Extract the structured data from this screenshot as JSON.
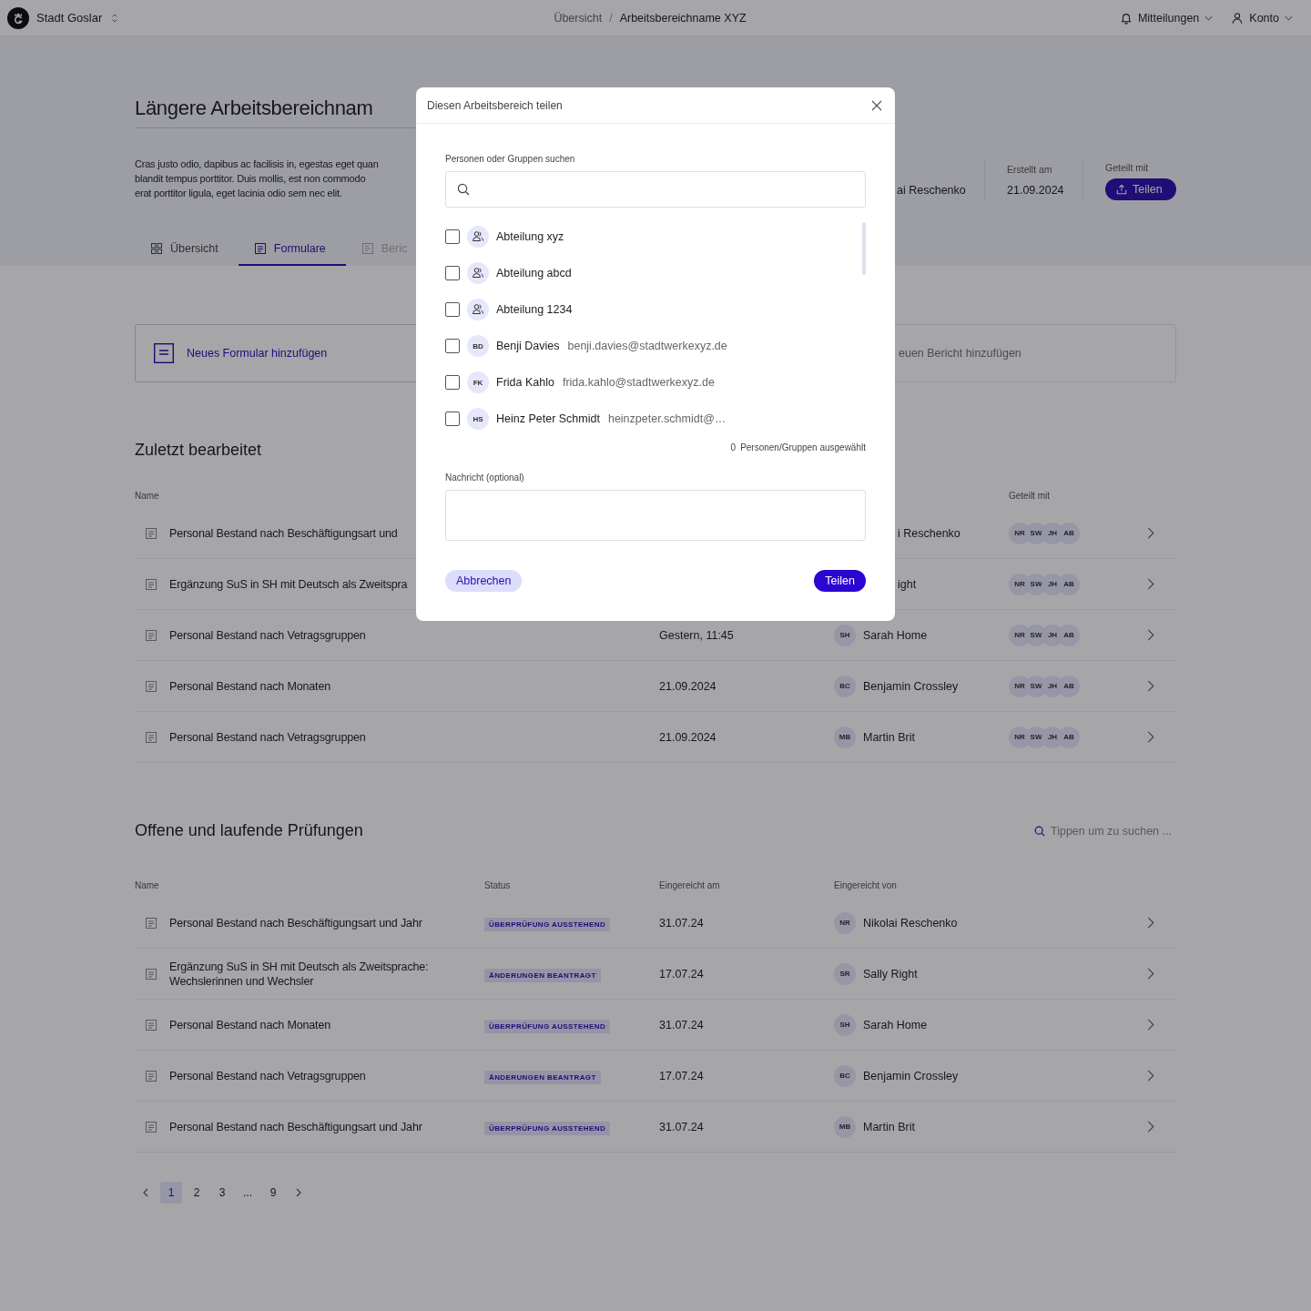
{
  "topbar": {
    "org": "Stadt Goslar",
    "breadcrumb": [
      {
        "label": "Übersicht",
        "current": false
      },
      {
        "label": "Arbeitsbereichname XYZ",
        "current": true
      }
    ],
    "breadcrumb_separator": "/",
    "notifications": "Mitteilungen",
    "account": "Konto"
  },
  "workspace": {
    "title": "Längere Arbeitsbereichnam",
    "description_lines": [
      "Cras justo odio, dapibus ac facilisis in, egestas eget quan",
      "blandit tempus porttitor. Duis mollis, est non commodo",
      "erat porttitor ligula, eget lacinia odio sem nec elit."
    ],
    "creator": "ai Reschenko",
    "created_label": "Erstellt am",
    "created": "21.09.2024",
    "shared_label": "Geteilt mit",
    "share_button": "Teilen"
  },
  "tabs": [
    {
      "label": "Übersicht",
      "selected": false,
      "disabled": false
    },
    {
      "label": "Formulare",
      "selected": true,
      "disabled": false
    },
    {
      "label": "Beric",
      "selected": false,
      "disabled": true
    }
  ],
  "actions": [
    {
      "label": "Neues Formular hinzufügen",
      "disabled": false
    },
    {
      "label": "euen Bericht hinzufügen",
      "disabled": true
    }
  ],
  "recent": {
    "title": "Zuletzt bearbeitet",
    "name_header": "Name",
    "shared_header": "Geteilt mit",
    "rows": [
      {
        "name": "Personal Bestand nach Beschäftigungsart und",
        "person": "i Reschenko",
        "shared": [
          "NR",
          "SW",
          "JH",
          "AB"
        ]
      },
      {
        "name": "Ergänzung SuS in SH mit Deutsch als Zweitspra",
        "person": "ight",
        "shared": [
          "NR",
          "SW",
          "JH",
          "AB"
        ]
      },
      {
        "name": "Personal Bestand nach Vetragsgruppen",
        "date": "Gestern, 11:45",
        "avatar": "SH",
        "person": "Sarah Home",
        "shared": [
          "NR",
          "SW",
          "JH",
          "AB"
        ]
      },
      {
        "name": "Personal Bestand nach Monaten",
        "date": "21.09.2024",
        "avatar": "BC",
        "person": "Benjamin Crossley",
        "shared": [
          "NR",
          "SW",
          "JH",
          "AB"
        ]
      },
      {
        "name": "Personal Bestand nach Vetragsgruppen",
        "date": "21.09.2024",
        "avatar": "MB",
        "person": "Martin Brit",
        "shared": [
          "NR",
          "SW",
          "JH",
          "AB"
        ]
      }
    ]
  },
  "reviews": {
    "title": "Offene und laufende Prüfungen",
    "search": {
      "placeholder": "Tippen um zu suchen ..."
    },
    "columns": [
      "Name",
      "Status",
      "Eingereicht am",
      "Eingereicht von"
    ],
    "rows": [
      {
        "name": "Personal Bestand nach Beschäftigungsart und Jahr",
        "status": "ÜBERPRÜFUNG AUSSTEHEND",
        "date": "31.07.24",
        "avatar": "NR",
        "person": "Nikolai Reschenko"
      },
      {
        "name": "Ergänzung SuS in SH mit Deutsch als Zweitsprache: Wechslerinnen und Wechsler",
        "status": "ÄNDERUNGEN BEANTRAGT",
        "date": "17.07.24",
        "avatar": "SR",
        "person": "Sally Right"
      },
      {
        "name": "Personal Bestand nach Monaten",
        "status": "ÜBERPRÜFUNG AUSSTEHEND",
        "date": "31.07.24",
        "avatar": "SH",
        "person": "Sarah Home"
      },
      {
        "name": "Personal Bestand nach Vetragsgruppen",
        "status": "ÄNDERUNGEN BEANTRAGT",
        "date": "17.07.24",
        "avatar": "BC",
        "person": "Benjamin Crossley"
      },
      {
        "name": "Personal Bestand nach Beschäftigungsart und Jahr",
        "status": "ÜBERPRÜFUNG AUSSTEHEND",
        "date": "31.07.24",
        "avatar": "MB",
        "person": "Martin Brit"
      }
    ]
  },
  "pagination": [
    {
      "label": "1",
      "selected": true
    },
    {
      "label": "2",
      "selected": false
    },
    {
      "label": "3",
      "selected": false
    },
    {
      "label": "...",
      "selected": false
    },
    {
      "label": "9",
      "selected": false
    }
  ],
  "dialog": {
    "title": "Diesen Arbeitsbereich teilen",
    "search_label": "Personen oder Gruppen suchen",
    "items": [
      {
        "kind": "group",
        "name": "Abteilung xyz",
        "checked": false
      },
      {
        "kind": "group",
        "name": "Abteilung abcd",
        "checked": false
      },
      {
        "kind": "group",
        "name": "Abteilung 1234",
        "checked": false
      },
      {
        "kind": "person",
        "initials": "BD",
        "name": "Benji Davies",
        "email": "benji.davies@stadtwerkexyz.de",
        "checked": false
      },
      {
        "kind": "person",
        "initials": "FK",
        "name": "Frida Kahlo",
        "email": "frida.kahlo@stadtwerkexyz.de",
        "checked": false
      },
      {
        "kind": "person",
        "initials": "HS",
        "name": "Heinz Peter Schmidt",
        "email": "heinzpeter.schmidt@…",
        "checked": false
      }
    ],
    "count": "0",
    "count_label": "Personen/Gruppen ausgewählt",
    "message_label": "Nachricht (optional)",
    "cancel": "Abbrechen",
    "submit": "Teilen"
  }
}
